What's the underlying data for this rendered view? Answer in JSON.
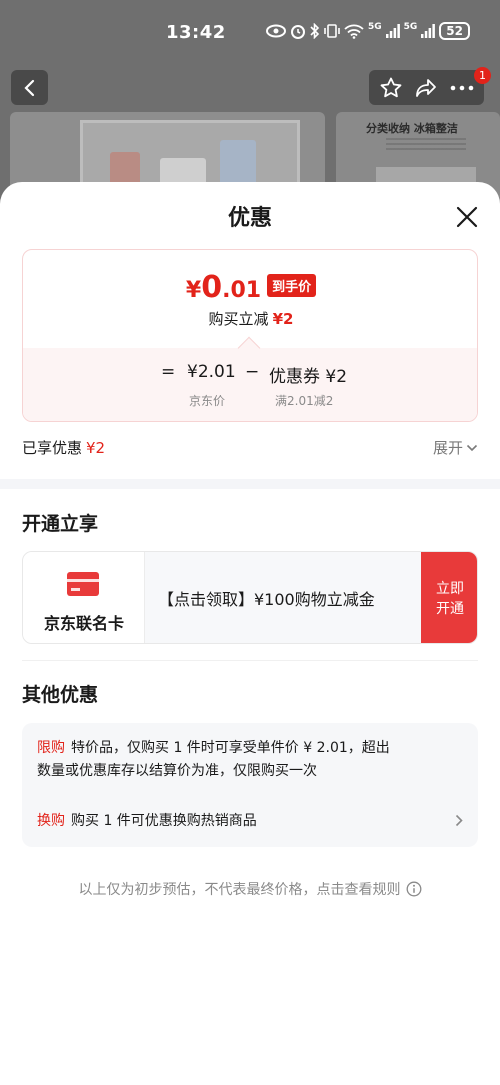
{
  "status_bar": {
    "time": "13:42",
    "signal_1": "5G",
    "signal_2": "5G",
    "battery": "52"
  },
  "product_page": {
    "photo_caption": "分类收纳 冰箱整洁",
    "cart_badge": "1"
  },
  "sheet": {
    "title": "优惠",
    "price": {
      "currency": "¥",
      "integer": "0",
      "decimal": ".01",
      "tag": "到手价"
    },
    "discount": {
      "label": "购买立减",
      "amount": "¥2"
    },
    "formula": {
      "equals": "=",
      "jd_price": "¥2.01",
      "minus": "−",
      "coupon": "优惠券 ¥2",
      "jd_price_label": "京东价",
      "coupon_label": "满2.01减2"
    },
    "enjoyed": {
      "label": "已享优惠",
      "amount": "¥2",
      "expand": "展开"
    },
    "open_section": {
      "title": "开通立享",
      "card_name": "京东联名卡",
      "offer": "【点击领取】¥100购物立减金",
      "button_line1": "立即",
      "button_line2": "开通"
    },
    "other_section": {
      "title": "其他优惠",
      "items": [
        {
          "tag": "限购",
          "line1": "特价品，仅购买 1 件时可享受单件价 ¥ 2.01，超出",
          "line2": "数量或优惠库存以结算价为准，仅限购买一次"
        },
        {
          "tag": "换购",
          "line1": "购买 1 件可优惠换购热销商品"
        }
      ]
    },
    "footer": "以上仅为初步预估，不代表最终价格，点击查看规则"
  },
  "colors": {
    "accent_red": "#e2231a",
    "button_red": "#e83a3a",
    "muted_text": "#8a8a8a"
  },
  "icons": [
    "back-arrow-icon",
    "star-icon",
    "share-icon",
    "more-icon",
    "close-icon",
    "chevron-down-icon",
    "credit-card-icon",
    "chevron-right-icon",
    "info-icon"
  ]
}
